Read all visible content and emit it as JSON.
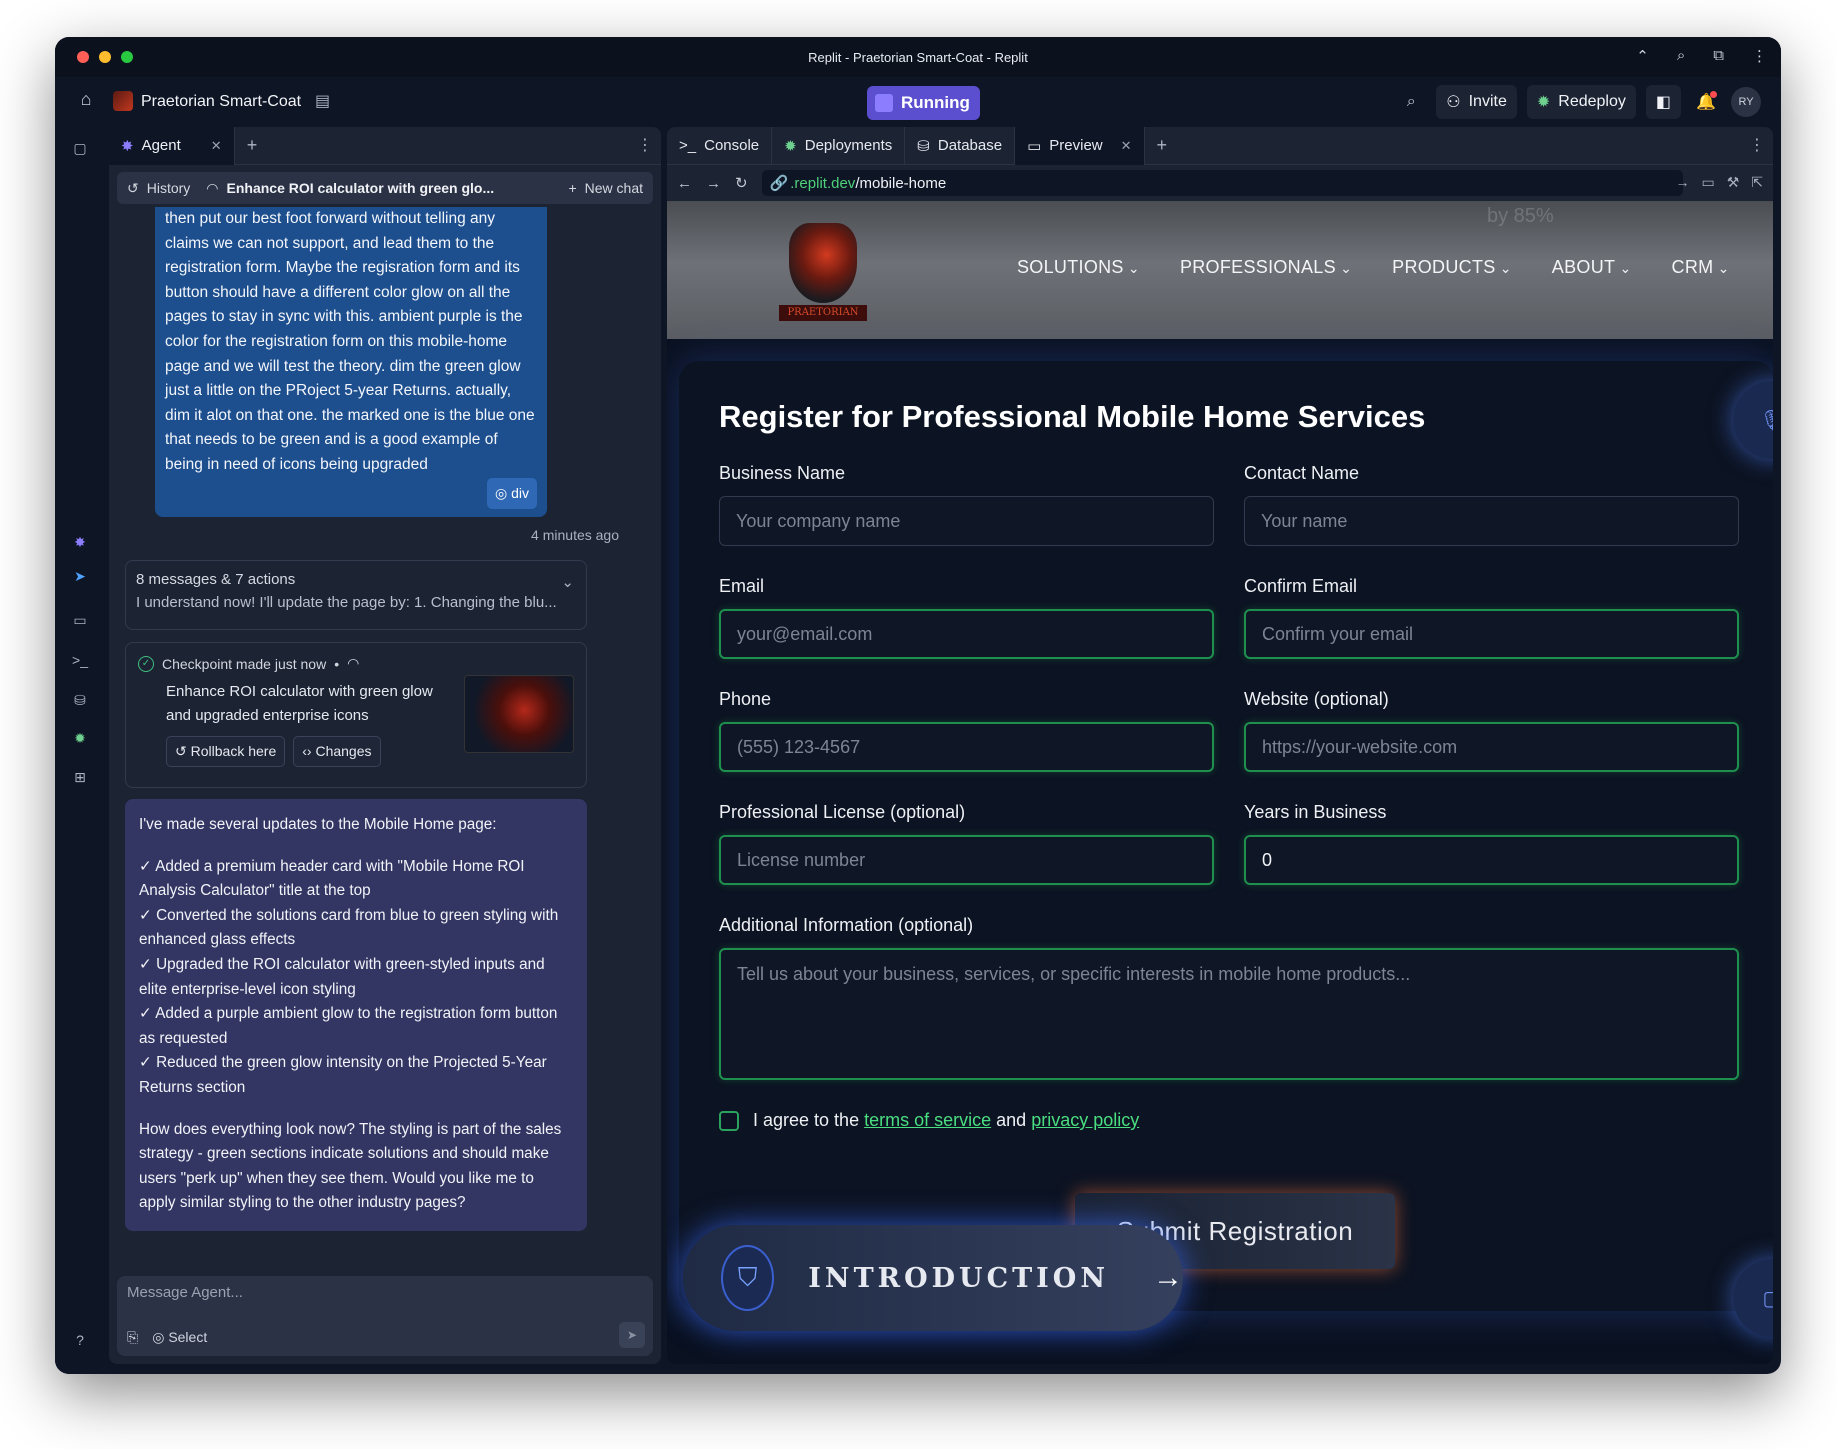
{
  "window": {
    "title": "Replit - Praetorian Smart-Coat - Replit",
    "traffic_colors": [
      "#ff5f57",
      "#febc2e",
      "#28c840"
    ]
  },
  "header": {
    "project_name": "Praetorian Smart-Coat",
    "run_status": "Running",
    "invite_label": "Invite",
    "redeploy_label": "Redeploy",
    "avatar_initials": "RY"
  },
  "agent_panel": {
    "tab_label": "Agent",
    "history_label": "History",
    "chat_title": "Enhance ROI calculator with green glo...",
    "new_chat_label": "New chat",
    "user_message": "then put our best foot forward without telling any claims we can not support, and lead them to the registration form. Maybe the regisration form and its button should have a different color glow on all the pages to stay in sync with this. ambient purple is the color for the registration form on this mobile-home page and we will test the theory. dim the green glow just a little on the PRoject 5-year Returns. actually, dim it alot on that one. the marked one is the blue one that needs to be green and is a good example of being in need of icons being upgraded",
    "element_chip": "div",
    "timestamp": "4 minutes ago",
    "summary_title": "8 messages & 7 actions",
    "summary_preview": "I understand now! I'll update the page by: 1. Changing the blu...",
    "checkpoint_header": "Checkpoint made just now",
    "checkpoint_title": "Enhance ROI calculator with green glow and upgraded enterprise icons",
    "rollback_label": "Rollback here",
    "changes_label": "Changes",
    "reply_intro": "I've made several updates to the Mobile Home page:",
    "reply_items": [
      "✓ Added a premium header card with \"Mobile Home ROI Analysis Calculator\" title at the top",
      "✓ Converted the solutions card from blue to green styling with enhanced glass effects",
      "✓ Upgraded the ROI calculator with green-styled inputs and elite enterprise-level icon styling",
      "✓ Added a purple ambient glow to the registration form button as requested",
      "✓ Reduced the green glow intensity on the Projected 5-Year Returns section"
    ],
    "reply_outro": "How does everything look now? The styling is part of the sales strategy - green sections indicate solutions and should make users \"perk up\" when they see them. Would you like me to apply similar styling to the other industry pages?",
    "composer_placeholder": "Message Agent...",
    "select_label": "Select"
  },
  "pane": {
    "tabs": [
      "Console",
      "Deployments",
      "Database",
      "Preview"
    ],
    "url_domain": ".replit.dev",
    "url_path": "/mobile-home"
  },
  "site": {
    "logo_text": "PRAETORIAN",
    "ghost_text": "by 85%",
    "nav": [
      "SOLUTIONS",
      "PROFESSIONALS",
      "PRODUCTS",
      "ABOUT",
      "CRM"
    ],
    "form_title": "Register for Professional Mobile Home Services",
    "fields": {
      "business_name": {
        "label": "Business Name",
        "placeholder": "Your company name"
      },
      "contact_name": {
        "label": "Contact Name",
        "placeholder": "Your name"
      },
      "email": {
        "label": "Email",
        "placeholder": "your@email.com"
      },
      "confirm_email": {
        "label": "Confirm Email",
        "placeholder": "Confirm your email"
      },
      "phone": {
        "label": "Phone",
        "placeholder": "(555) 123-4567"
      },
      "website": {
        "label": "Website (optional)",
        "placeholder": "https://your-website.com"
      },
      "license": {
        "label": "Professional License (optional)",
        "placeholder": "License number"
      },
      "years": {
        "label": "Years in Business",
        "value": "0"
      },
      "additional": {
        "label": "Additional Information (optional)",
        "placeholder": "Tell us about your business, services, or specific interests in mobile home products..."
      }
    },
    "agree_prefix": "I agree to the",
    "terms_label": "terms of service",
    "agree_and": "and",
    "privacy_label": "privacy policy",
    "submit_label": "Submit Registration",
    "intro_label": "INTRODUCTION"
  },
  "colors": {
    "accent_green": "#4ade80",
    "running_purple": "#5b4fcf",
    "user_bubble": "#1d4e8e",
    "agent_bubble": "#333663"
  }
}
